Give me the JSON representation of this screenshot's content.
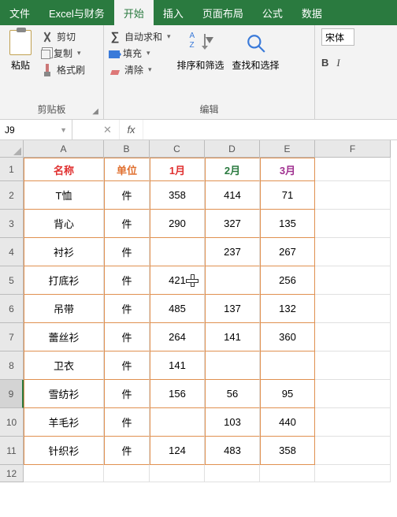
{
  "tabs": {
    "file": "文件",
    "custom": "Excel与财务",
    "home": "开始",
    "insert": "插入",
    "layout": "页面布局",
    "formulas": "公式",
    "data": "数据"
  },
  "ribbon": {
    "clipboard": {
      "paste": "粘贴",
      "cut": "剪切",
      "copy": "复制",
      "brush": "格式刷",
      "group": "剪贴板"
    },
    "editing": {
      "autosum": "自动求和",
      "fill": "填充",
      "clear": "清除",
      "sortfilter": "排序和筛选",
      "findselect": "查找和选择",
      "group": "编辑"
    },
    "font": {
      "name": "宋体",
      "bold": "B",
      "italic": "I"
    }
  },
  "namebox": "J9",
  "fx_cancel": "✕",
  "fx_label": "fx",
  "columns": [
    "A",
    "B",
    "C",
    "D",
    "E",
    "F"
  ],
  "headers": {
    "name": "名称",
    "unit": "单位",
    "m1": "1月",
    "m2": "2月",
    "m3": "3月"
  },
  "rows": [
    {
      "n": 1
    },
    {
      "n": 2,
      "a": "T恤",
      "b": "件",
      "c": "358",
      "d": "414",
      "e": "71"
    },
    {
      "n": 3,
      "a": "背心",
      "b": "件",
      "c": "290",
      "d": "327",
      "e": "135"
    },
    {
      "n": 4,
      "a": "衬衫",
      "b": "件",
      "c": "",
      "d": "237",
      "e": "267"
    },
    {
      "n": 5,
      "a": "打底衫",
      "b": "件",
      "c": "421",
      "d": "",
      "e": "256"
    },
    {
      "n": 6,
      "a": "吊带",
      "b": "件",
      "c": "485",
      "d": "137",
      "e": "132"
    },
    {
      "n": 7,
      "a": "蕾丝衫",
      "b": "件",
      "c": "264",
      "d": "141",
      "e": "360"
    },
    {
      "n": 8,
      "a": "卫衣",
      "b": "件",
      "c": "141",
      "d": "",
      "e": ""
    },
    {
      "n": 9,
      "a": "雪纺衫",
      "b": "件",
      "c": "156",
      "d": "56",
      "e": "95"
    },
    {
      "n": 10,
      "a": "羊毛衫",
      "b": "件",
      "c": "",
      "d": "103",
      "e": "440"
    },
    {
      "n": 11,
      "a": "针织衫",
      "b": "件",
      "c": "124",
      "d": "483",
      "e": "358"
    },
    {
      "n": 12
    }
  ],
  "chart_data": {
    "type": "table",
    "title": "",
    "columns": [
      "名称",
      "单位",
      "1月",
      "2月",
      "3月"
    ],
    "data": [
      [
        "T恤",
        "件",
        358,
        414,
        71
      ],
      [
        "背心",
        "件",
        290,
        327,
        135
      ],
      [
        "衬衫",
        "件",
        null,
        237,
        267
      ],
      [
        "打底衫",
        "件",
        421,
        null,
        256
      ],
      [
        "吊带",
        "件",
        485,
        137,
        132
      ],
      [
        "蕾丝衫",
        "件",
        264,
        141,
        360
      ],
      [
        "卫衣",
        "件",
        141,
        null,
        null
      ],
      [
        "雪纺衫",
        "件",
        156,
        56,
        95
      ],
      [
        "羊毛衫",
        "件",
        null,
        103,
        440
      ],
      [
        "针织衫",
        "件",
        124,
        483,
        358
      ]
    ]
  }
}
